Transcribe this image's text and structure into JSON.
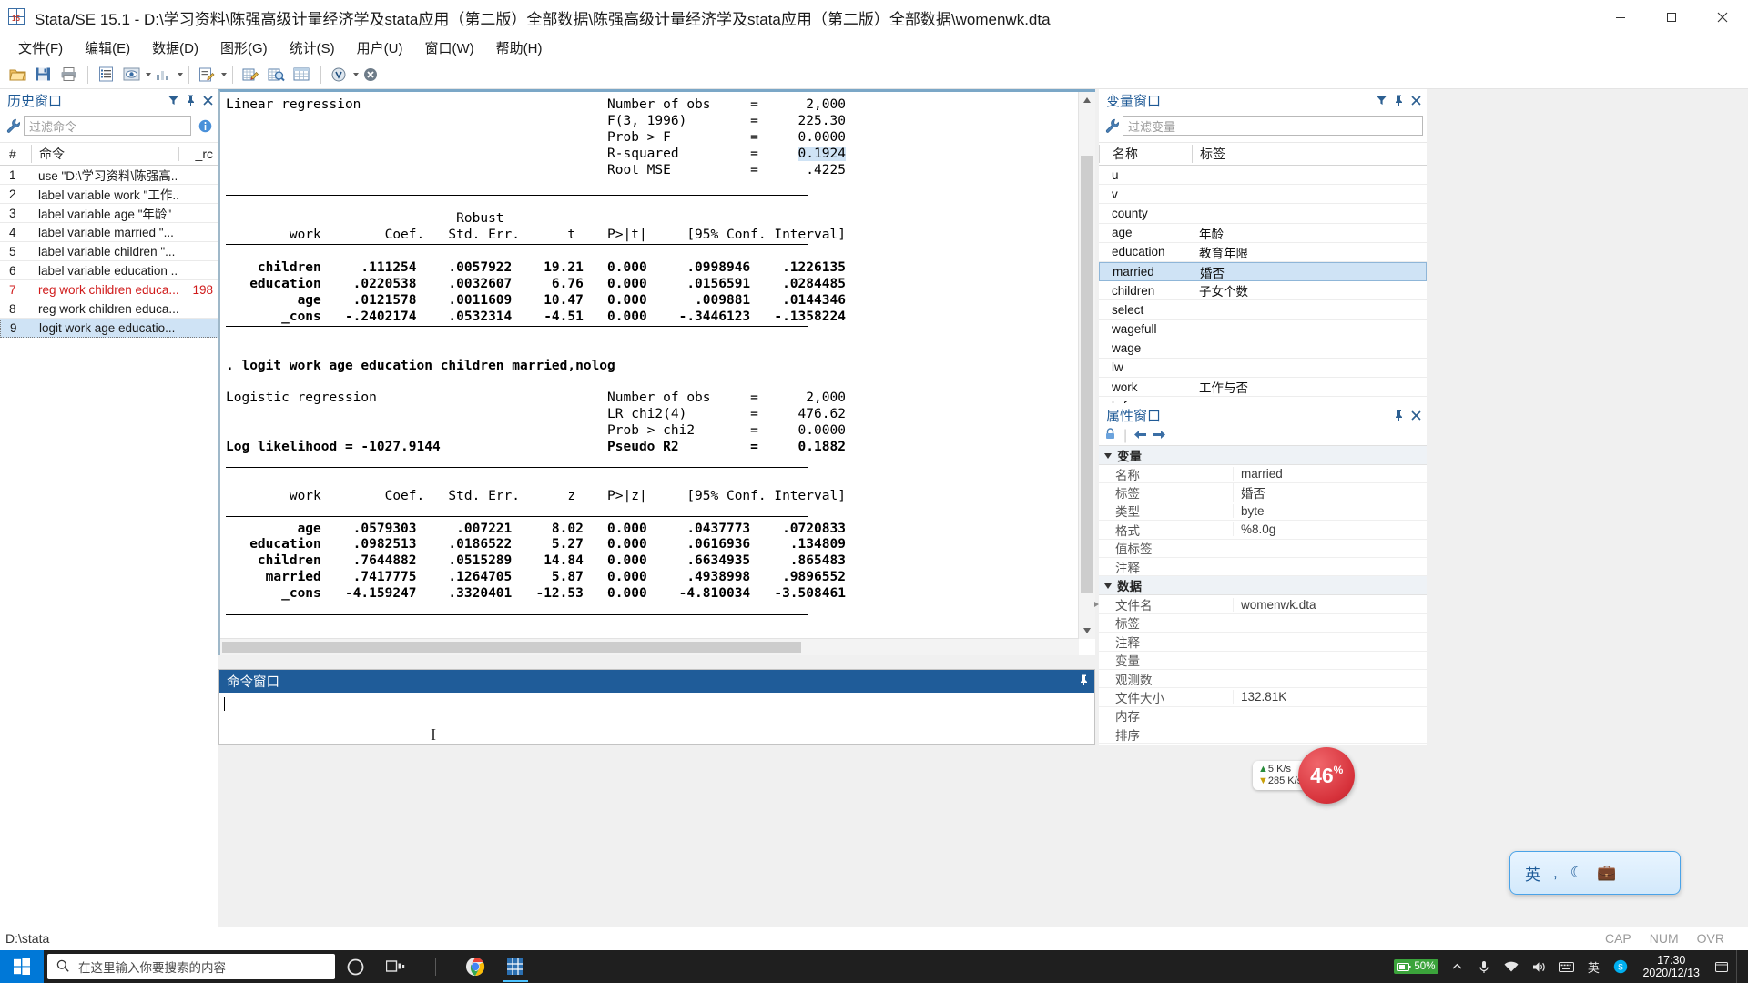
{
  "window": {
    "title": "Stata/SE 15.1 - D:\\学习资料\\陈强高级计量经济学及stata应用（第二版）全部数据\\陈强高级计量经济学及stata应用（第二版）全部数据\\womenwk.dta",
    "icon": "stata-grid-icon",
    "minimize_label": "最小化",
    "maximize_label": "最大化",
    "close_label": "关闭"
  },
  "menubar": {
    "items": [
      {
        "label": "文件(F)",
        "name": "menu-file"
      },
      {
        "label": "编辑(E)",
        "name": "menu-edit"
      },
      {
        "label": "数据(D)",
        "name": "menu-data"
      },
      {
        "label": "图形(G)",
        "name": "menu-graphics"
      },
      {
        "label": "统计(S)",
        "name": "menu-statistics"
      },
      {
        "label": "用户(U)",
        "name": "menu-user"
      },
      {
        "label": "窗口(W)",
        "name": "menu-window"
      },
      {
        "label": "帮助(H)",
        "name": "menu-help"
      }
    ]
  },
  "toolbar": {
    "buttons": [
      "open-icon",
      "save-icon",
      "print-icon",
      "log-icon",
      "viewer-icon",
      "graph-icon",
      "do-editor-icon",
      "data-editor-edit-icon",
      "data-editor-browse-icon",
      "variables-manager-icon",
      "break-icon",
      "stop-icon"
    ]
  },
  "history": {
    "title": "历史窗口",
    "filter_placeholder": "过滤命令",
    "columns": {
      "num": "#",
      "command": "命令",
      "rc": "_rc"
    },
    "rows": [
      {
        "num": "1",
        "command": "use \"D:\\学习资料\\陈强高...",
        "rc": "",
        "error": false,
        "selected": false
      },
      {
        "num": "2",
        "command": "label variable work \"工作...",
        "rc": "",
        "error": false,
        "selected": false
      },
      {
        "num": "3",
        "command": "label variable age \"年龄\"",
        "rc": "",
        "error": false,
        "selected": false
      },
      {
        "num": "4",
        "command": "label variable married \"...",
        "rc": "",
        "error": false,
        "selected": false
      },
      {
        "num": "5",
        "command": "label variable children \"...",
        "rc": "",
        "error": false,
        "selected": false
      },
      {
        "num": "6",
        "command": "label variable education ...",
        "rc": "",
        "error": false,
        "selected": false
      },
      {
        "num": "7",
        "command": "reg work children educa...",
        "rc": "198",
        "error": true,
        "selected": false
      },
      {
        "num": "8",
        "command": "reg work children educa...",
        "rc": "",
        "error": false,
        "selected": false
      },
      {
        "num": "9",
        "command": "logit work age educatio...",
        "rc": "",
        "error": false,
        "selected": true
      }
    ]
  },
  "results": {
    "lines": [
      "Linear regression                               Number of obs     =      2,000",
      "                                                F(3, 1996)        =     225.30",
      "                                                Prob > F          =     0.0000",
      "                                                R-squared         =     0.1924",
      "                                                Root MSE          =      .4225",
      "",
      "",
      "                             Robust",
      "        work        Coef.   Std. Err.      t    P>|t|     [95% Conf. Interval]",
      "",
      "    children     .111254    .0057922    19.21   0.000     .0998946    .1226135",
      "   education    .0220538    .0032607     6.76   0.000     .0156591    .0284485",
      "         age    .0121578    .0011609    10.47   0.000      .009881    .0144346",
      "       _cons   -.2402174    .0532314    -4.51   0.000    -.3446123   -.1358224",
      "",
      "",
      ". logit work age education children married,nolog",
      "",
      "Logistic regression                             Number of obs     =      2,000",
      "                                                LR chi2(4)        =     476.62",
      "                                                Prob > chi2       =     0.0000",
      "Log likelihood = -1027.9144                     Pseudo R2         =     0.1882",
      "",
      "",
      "        work        Coef.   Std. Err.      z    P>|z|     [95% Conf. Interval]",
      "",
      "         age    .0579303     .007221     8.02   0.000     .0437773    .0720833",
      "   education    .0982513    .0186522     5.27   0.000     .0616936     .134809",
      "    children    .7644882    .0515289    14.84   0.000     .6634935     .865483",
      "     married    .7417775    .1264705     5.87   0.000     .4938998    .9896552",
      "       _cons   -4.159247    .3320401   -12.53   0.000    -4.810034   -3.508461",
      "",
      "",
      "."
    ],
    "highlight_value": "0.1924",
    "header_linear": "Linear regression",
    "header_logistic": "Logistic regression",
    "command_echo": ". logit work age education children married,nolog"
  },
  "command_window": {
    "title": "命令窗口",
    "value": "",
    "pin_label": "固定"
  },
  "variables": {
    "title": "变量窗口",
    "filter_placeholder": "过滤变量",
    "columns": {
      "name": "名称",
      "label": "标签"
    },
    "rows": [
      {
        "name": "u",
        "label": "",
        "selected": false
      },
      {
        "name": "v",
        "label": "",
        "selected": false
      },
      {
        "name": "county",
        "label": "",
        "selected": false
      },
      {
        "name": "age",
        "label": "年龄",
        "selected": false
      },
      {
        "name": "education",
        "label": "教育年限",
        "selected": false
      },
      {
        "name": "married",
        "label": "婚否",
        "selected": true
      },
      {
        "name": "children",
        "label": "子女个数",
        "selected": false
      },
      {
        "name": "select",
        "label": "",
        "selected": false
      },
      {
        "name": "wagefull",
        "label": "",
        "selected": false
      },
      {
        "name": "wage",
        "label": "",
        "selected": false
      },
      {
        "name": "lw",
        "label": "",
        "selected": false
      },
      {
        "name": "work",
        "label": "工作与否",
        "selected": false
      },
      {
        "name": "lwf",
        "label": "",
        "selected": false
      }
    ]
  },
  "properties": {
    "title": "属性窗口",
    "lock_icon": "lock-icon",
    "back_icon": "arrow-left-icon",
    "forward_icon": "arrow-right-icon",
    "groups": [
      {
        "name": "变量",
        "rows": [
          {
            "key": "名称",
            "value": "married"
          },
          {
            "key": "标签",
            "value": "婚否"
          },
          {
            "key": "类型",
            "value": "byte"
          },
          {
            "key": "格式",
            "value": "%8.0g"
          },
          {
            "key": "值标签",
            "value": ""
          },
          {
            "key": "注释",
            "value": ""
          }
        ]
      },
      {
        "name": "数据",
        "rows": [
          {
            "key": "文件名",
            "value": "womenwk.dta",
            "expandable": true
          },
          {
            "key": "标签",
            "value": ""
          },
          {
            "key": "注释",
            "value": ""
          },
          {
            "key": "变量",
            "value": ""
          },
          {
            "key": "观测数",
            "value": ""
          },
          {
            "key": "文件大小",
            "value": "132.81K"
          },
          {
            "key": "内存",
            "value": ""
          },
          {
            "key": "排序",
            "value": ""
          }
        ]
      }
    ]
  },
  "statusbar": {
    "path": "D:\\stata",
    "indicators": [
      "CAP",
      "NUM",
      "OVR"
    ]
  },
  "taskbar": {
    "start_icon": "windows-start-icon",
    "search_placeholder": "在这里输入你要搜索的内容",
    "search_icon": "search-icon",
    "items": [
      {
        "name": "cortana-icon",
        "label": ""
      },
      {
        "name": "task-view-icon",
        "label": ""
      },
      {
        "name": "app-divider",
        "label": ""
      },
      {
        "name": "chrome-icon",
        "label": ""
      },
      {
        "name": "stata-taskbar-icon",
        "label": ""
      }
    ],
    "tray": {
      "battery_percent": "50%",
      "chevron_icon": "chevron-up-icon",
      "mic_icon": "microphone-icon",
      "wifi_icon": "wifi-icon",
      "volume_icon": "speaker-icon",
      "keyboard_icon": "keyboard-icon",
      "ime_icon": "ime-icon",
      "skype_icon": "skype-icon",
      "time": "17:30",
      "date": "2020/12/13",
      "notification_icon": "notification-icon"
    }
  },
  "widgets": {
    "netspeed": {
      "upload": "5  K/s",
      "download": "285 K/s",
      "cpu_percent": "46",
      "cpu_unit": "%"
    },
    "ime": {
      "mode": "英",
      "tone_icon": "comma-icon",
      "moon_icon": "moon-icon",
      "toolbox_icon": "toolbox-icon"
    }
  },
  "colors": {
    "accent": "#1f5c99",
    "panel_title": "#1f5a96",
    "error_text": "#d01b1b",
    "selection": "#cfe3f5",
    "taskbar": "#1f1f1f",
    "start_blue": "#0078d7",
    "battery_green": "#3ba33b",
    "speed_red": "#d6313a"
  }
}
